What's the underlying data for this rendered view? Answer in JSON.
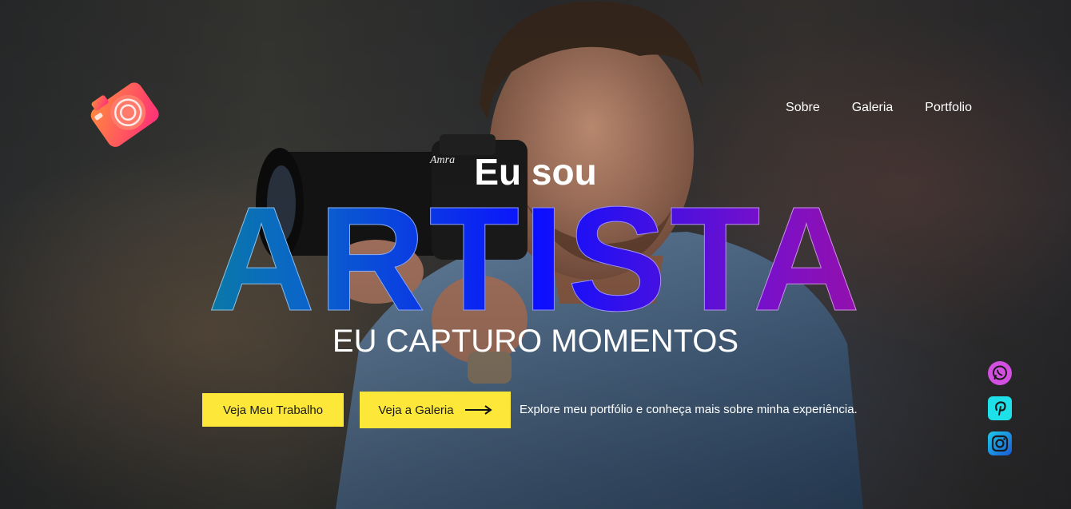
{
  "nav": {
    "items": [
      {
        "label": "Sobre"
      },
      {
        "label": "Galeria"
      },
      {
        "label": "Portfolio"
      }
    ]
  },
  "hero": {
    "intro": "Eu sou",
    "title": "ARTISTA",
    "tagline": "EU CAPTURO MOMENTOS",
    "description": "Explore meu portfólio e conheça mais sobre minha experiência."
  },
  "buttons": {
    "work_label": "Veja Meu Trabalho",
    "gallery_label": "Veja a Galeria"
  },
  "camera_brand": "Amra",
  "socials": [
    {
      "icon": "whatsapp-icon",
      "color": "#d24fe0"
    },
    {
      "icon": "pinterest-icon",
      "color": "#1ee0e8"
    },
    {
      "icon": "instagram-icon",
      "color": "#1ec8e8"
    }
  ],
  "colors": {
    "button": "#fde83a",
    "logo_gradient": [
      "#ff6a3d",
      "#ff2d7a"
    ],
    "title_gradient": [
      "#0aa35a",
      "#0a66c8",
      "#0a10ff",
      "#7a10c8",
      "#d0106a"
    ]
  }
}
